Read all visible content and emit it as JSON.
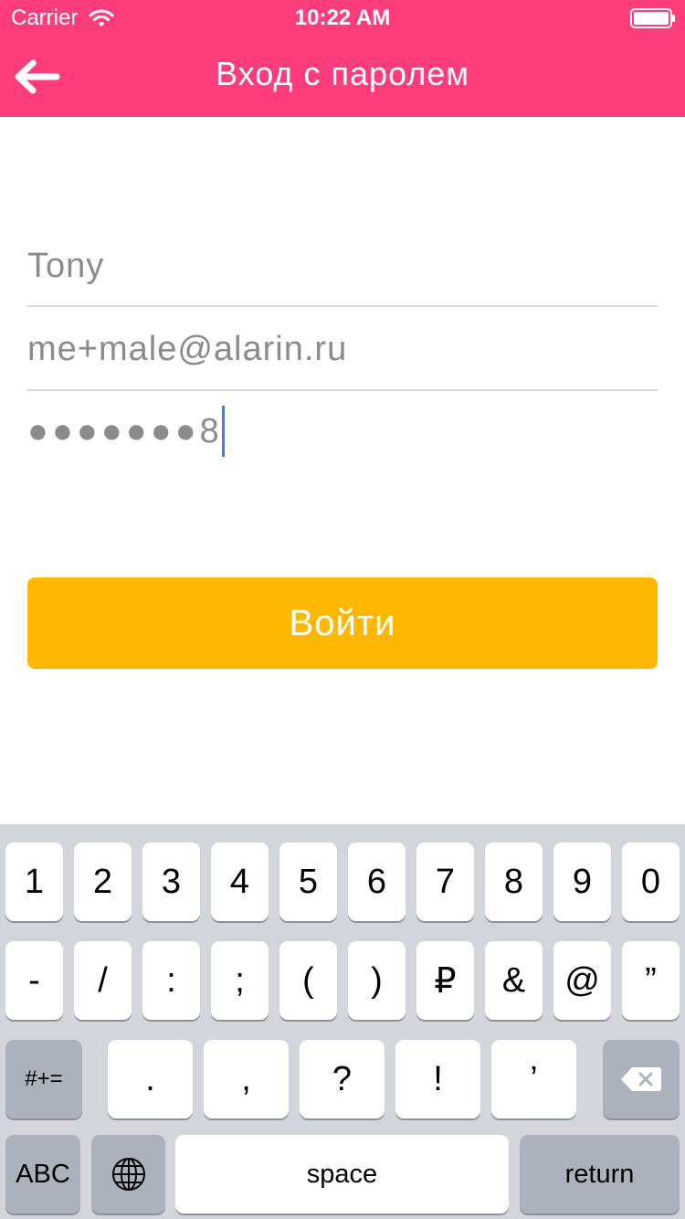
{
  "theme": {
    "accent": "#ff3d7d",
    "button": "#ffb800"
  },
  "status_bar": {
    "carrier": "Carrier",
    "time": "10:22 AM"
  },
  "nav": {
    "back_icon": "arrow-left-icon",
    "title": "Вход с паролем"
  },
  "form": {
    "name_value": "Tony",
    "email_value": "me+male@alarin.ru",
    "password_masked": "●●●●●●●",
    "password_last_char": "8"
  },
  "login_button": {
    "label": "Войти"
  },
  "keyboard": {
    "row1": [
      "1",
      "2",
      "3",
      "4",
      "5",
      "6",
      "7",
      "8",
      "9",
      "0"
    ],
    "row2": [
      "-",
      "/",
      ":",
      ";",
      "(",
      ")",
      "₽",
      "&",
      "@",
      "”"
    ],
    "row3_mode": "#+=",
    "row3": [
      ".",
      ",",
      "?",
      "!",
      "’"
    ],
    "row3_backspace_icon": "backspace-icon",
    "row4_abc": "ABC",
    "row4_globe_icon": "globe-icon",
    "row4_space": "space",
    "row4_return": "return"
  }
}
